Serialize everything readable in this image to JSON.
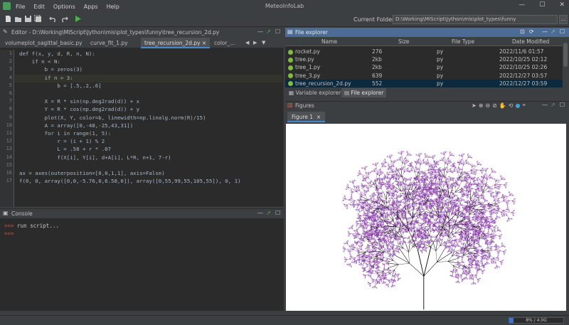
{
  "app": {
    "title": "MeteoInfoLab",
    "menu": [
      "File",
      "Edit",
      "Options",
      "Apps",
      "Help"
    ],
    "window_controls": [
      "—",
      "☐",
      "✕"
    ]
  },
  "toolbar": {
    "icons": [
      "new-file-icon",
      "open-file-icon",
      "save-icon",
      "save-all-icon",
      "undo-icon",
      "redo-icon",
      "run-icon"
    ],
    "current_folder_label": "Current Folder:",
    "current_folder_value": "D:\\Working\\MIScript\\Jython\\mis\\plot_types\\funny",
    "browse_label": "..."
  },
  "editor": {
    "title": "Editor - D:\\Working\\MIScript\\Jython\\mis\\plot_types\\funny\\tree_recursion_2d.py",
    "tabs": [
      {
        "label": "volumeplot_sagittal_basic.py"
      },
      {
        "label": "curve_fit_1.py"
      },
      {
        "label": "tree_recursion_2d.py",
        "active": true
      },
      {
        "label": "color_..."
      }
    ],
    "tab_close": "×",
    "line_numbers": [
      "1",
      "2",
      "3",
      "4",
      "5",
      "6",
      "7",
      "8",
      "9",
      "10",
      "11",
      "12",
      "13",
      "14",
      "15",
      "16",
      "17"
    ],
    "lines": [
      "def f(x, y, d, R, n, N):",
      "    if n < N:",
      "        b = zeros(3)",
      "        if n > 3:",
      "            b = [.5,.2,.6]",
      "",
      "        X = R * sin(np.deg2rad(d)) + x",
      "        Y = R * cos(np.deg2rad(d)) + y",
      "        plot(X, Y, color=b, linewidth=np.linalg.norm(R)/15)",
      "        A = array([0,-48,-25,43,31])",
      "        for i in range(1, 5):",
      "            r = (i + 1) % 2",
      "            L = .58 + r * .07",
      "            f(X[i], Y[i], d+A[i], L*R, n+1, 7-r)",
      "",
      "ax = axes(outerposition=[0,0,1,1], axis=False)",
      "f(0, 0, array([0,0,-5.76,0,6.58,0]), array([0,55,99,55,105,55]), 0, 1)"
    ],
    "highlight_line": 4
  },
  "console": {
    "title": "Console",
    "lines": [
      {
        "prompt": ">>>",
        "text": " run script..."
      },
      {
        "prompt": ">>>",
        "text": ""
      }
    ]
  },
  "file_explorer": {
    "title": "File explorer",
    "columns": [
      "Name",
      "Size",
      "File Type",
      "Date Modified"
    ],
    "rows": [
      {
        "name": "rocket.py",
        "size": "276",
        "type": "py",
        "date": "2022/11/6 01:57"
      },
      {
        "name": "tree.py",
        "size": "2kb",
        "type": "py",
        "date": "2022/10/25 02:12"
      },
      {
        "name": "tree_1.py",
        "size": "2kb",
        "type": "py",
        "date": "2022/10/25 02:26"
      },
      {
        "name": "tree_3.py",
        "size": "639",
        "type": "py",
        "date": "2022/12/27 03:57"
      },
      {
        "name": "tree_recursion_2d.py",
        "size": "552",
        "type": "py",
        "date": "2022/12/27 03:59",
        "selected": true
      }
    ],
    "bottom_tabs": [
      {
        "label": "Variable explorer"
      },
      {
        "label": "File explorer",
        "active": true
      }
    ]
  },
  "figures": {
    "title": "Figures",
    "tab_label": "Figure 1",
    "tab_close": "×",
    "tools": [
      "pointer-icon",
      "zoom-in-icon",
      "zoom-out-icon",
      "pan-icon",
      "reset-icon",
      "identify-icon",
      "measure-icon"
    ],
    "colors": {
      "trunk": "#000000",
      "leaves": "#8033a0"
    }
  },
  "status": {
    "memory_text": "8% / 4.0G",
    "memory_fraction": 0.08
  },
  "colors": {
    "accent": "#4a88c7",
    "explorer_header": "#4c6b95",
    "keyword": "#cc7832",
    "number": "#6897bb",
    "background": "#2b2b2b"
  }
}
